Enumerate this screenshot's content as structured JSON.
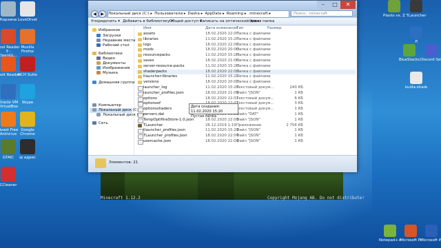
{
  "desktop": {
    "left_icons": [
      {
        "label": "Корзина",
        "color": "#9fb7c9"
      },
      {
        "label": "LoveOtvet",
        "color": "#e6e6e6"
      },
      {
        "label": "Cool Reader 3 - OpenGL...",
        "color": "#d94a2a"
      },
      {
        "label": "Mozilla Firefox",
        "color": "#e5712b"
      },
      {
        "label": "Foxit Reader",
        "color": "#e8561e"
      },
      {
        "label": "NCH Suite",
        "color": "#c21f1f"
      },
      {
        "label": "Oracle VM VirtualBox",
        "color": "#2f6fbe"
      },
      {
        "label": "Skype",
        "color": "#1fa2e0"
      },
      {
        "label": "Avast Free Antivirus",
        "color": "#f07a1a"
      },
      {
        "label": "Google Chrome",
        "color": "#e0b41d"
      },
      {
        "label": "GTAIC",
        "color": "#5b7b2c"
      },
      {
        "label": "ip адрес",
        "color": "#2d2d2d"
      },
      {
        "label": "CCleaner",
        "color": "#d22f2f"
      }
    ],
    "right_icons": [
      {
        "label": "Plants vs. Zombies",
        "color": "#6fa23a"
      },
      {
        "label": "TLauncher",
        "color": "#3a3a3a"
      },
      {
        "label": "Л",
        "color": "#2a6fc2"
      },
      {
        "label": "BlueStacks",
        "color": "#5da53b"
      },
      {
        "label": "Discord Setup",
        "color": "#4a5ed0"
      },
      {
        "label": "kuida-shade...",
        "color": "#e9e9e9"
      },
      {
        "label": "Notepad++",
        "color": "#7ab33d"
      },
      {
        "label": "Microsoft PowerPoint...",
        "color": "#d2562a"
      },
      {
        "label": "Microsoft Word 2010",
        "color": "#2b5fb8"
      }
    ]
  },
  "minecraft": {
    "title": "Minecraft 1.12.2",
    "copyright": "Copyright Mojang AB. Do not distribute!"
  },
  "explorer": {
    "address_parts": [
      "Локальный диск (C:)",
      "Пользователи",
      "Dasha",
      "AppData",
      "Roaming",
      ".minecraft"
    ],
    "search_placeholder": "Поиск: .minecraft",
    "controls": {
      "min": "–",
      "max": "□",
      "close": "✕",
      "back": "◀",
      "forward": "▶"
    },
    "toolbar": [
      "Упорядочить ▾",
      "Добавить в библиотеку ▾",
      "Общий доступ ▾",
      "Записать на оптический диск",
      "Новая папка"
    ],
    "nav": [
      {
        "label": "Избранное",
        "color": "#f0c53a"
      },
      {
        "label": "Загрузки",
        "color": "#3a7bd5"
      },
      {
        "label": "Недавние места",
        "color": "#6a8fb8"
      },
      {
        "label": "Рабочий стол",
        "color": "#3b6bb0"
      },
      {
        "label": "Библиотеки",
        "color": "#e1b84a"
      },
      {
        "label": "Видео",
        "color": "#6a6a9a"
      },
      {
        "label": "Документы",
        "color": "#caa24a"
      },
      {
        "label": "Изображения",
        "color": "#5a9ad0"
      },
      {
        "label": "Музыка",
        "color": "#d0853a"
      },
      {
        "label": "Домашняя группа",
        "color": "#3a8ad0"
      },
      {
        "label": "Компьютер",
        "color": "#7a8ea8"
      },
      {
        "label": "Локальный диск (C:)",
        "color": "#8a9ab0"
      },
      {
        "label": "Локальный диск (D:)",
        "color": "#8a9ab0"
      },
      {
        "label": "Сеть",
        "color": "#5a7aa8"
      }
    ],
    "headers": {
      "name": "Имя",
      "date": "Дата изменения",
      "type": "Тип",
      "size": "Размер"
    },
    "files": [
      {
        "name": "assets",
        "date": "18.02.2020 22:07",
        "type": "Папка с файлами",
        "size": "",
        "color": "#e7c55a"
      },
      {
        "name": "libraries",
        "date": "11.02.2020 15:27",
        "type": "Папка с файлами",
        "size": "",
        "color": "#e7c55a"
      },
      {
        "name": "logs",
        "date": "18.02.2020 22:01",
        "type": "Папка с файлами",
        "size": "",
        "color": "#e7c55a"
      },
      {
        "name": "mods",
        "date": "18.02.2020 20:00",
        "type": "Папка с файлами",
        "size": "",
        "color": "#e7c55a"
      },
      {
        "name": "resourcepacks",
        "date": "11.02.2020 15:20",
        "type": "Папка с файлами",
        "size": "",
        "color": "#e7c55a"
      },
      {
        "name": "saves",
        "date": "18.02.2020 21:06",
        "type": "Папка с файлами",
        "size": "",
        "color": "#e7c55a"
      },
      {
        "name": "server-resource-packs",
        "date": "11.02.2020 15:20",
        "type": "Папка с файлами",
        "size": "",
        "color": "#e7c55a"
      },
      {
        "name": "shaderpacks",
        "date": "18.02.2020 22:03",
        "type": "Папка с файлами",
        "size": "",
        "color": "#e7c55a"
      },
      {
        "name": "tlauncher-libraries",
        "date": "11.02.2020 15:21",
        "type": "Папка с файлами",
        "size": "",
        "color": "#e7c55a"
      },
      {
        "name": "versions",
        "date": "18.02.2020 20:02",
        "type": "Папка с файлами",
        "size": "",
        "color": "#e7c55a"
      },
      {
        "name": "launcher_log",
        "date": "11.02.2020 15:20",
        "type": "Текстовый докум...",
        "size": "240 КБ",
        "color": "#f2f2f2"
      },
      {
        "name": "launcher_profiles.json",
        "date": "18.02.2020 21:09",
        "type": "Файл \"JSON\"",
        "size": "1 КБ",
        "color": "#f2f2f2"
      },
      {
        "name": "options",
        "date": "18.02.2020 22:01",
        "type": "Текстовый докум...",
        "size": "6 КБ",
        "color": "#f2f2f2"
      },
      {
        "name": "optionsof",
        "date": "18.02.2020 22:01",
        "type": "Текстовый докум...",
        "size": "3 КБ",
        "color": "#f2f2f2"
      },
      {
        "name": "optionsshaders",
        "date": "18.02.2020 22:01",
        "type": "Текстовый докум...",
        "size": "1 КБ",
        "color": "#f2f2f2"
      },
      {
        "name": "servers.dat",
        "date": "11.02.2020 15:20",
        "type": "Файл \"DAT\"",
        "size": "1 КБ",
        "color": "#f2f2f2"
      },
      {
        "name": "TempOptifineStore-1.0.json",
        "date": "18.02.2020 22:03",
        "type": "Файл \"JSON\"",
        "size": "1 КБ",
        "color": "#f2f2f2"
      },
      {
        "name": "TLauncher",
        "date": "26.12.2019 1:19",
        "type": "Приложение",
        "size": "2 756 КБ",
        "color": "#7a5a32"
      },
      {
        "name": "tlauncher_profiles.json",
        "date": "11.02.2020 15:23",
        "type": "Файл \"JSON\"",
        "size": "1 КБ",
        "color": "#f2f2f2"
      },
      {
        "name": "TLauncher_profiles.json",
        "date": "18.02.2020 22:07",
        "type": "Файл \"JSON\"",
        "size": "1 КБ",
        "color": "#f2f2f2"
      },
      {
        "name": "usercache.json",
        "date": "18.02.2020 22:01",
        "type": "Файл \"JSON\"",
        "size": "1 КБ",
        "color": "#f2f2f2"
      }
    ],
    "tooltip": {
      "line1": "Дата создания: 11.02.2020 15:20",
      "line2": "Пустая папка"
    },
    "status": "Элементов: 21"
  }
}
